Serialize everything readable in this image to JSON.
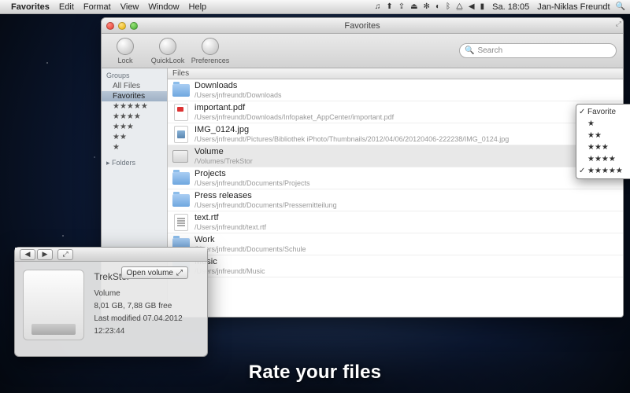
{
  "menubar": {
    "app": "Favorites",
    "items": [
      "Edit",
      "Format",
      "View",
      "Window",
      "Help"
    ],
    "clock": "Sa. 18:05",
    "user": "Jan-Niklas Freundt"
  },
  "window": {
    "title": "Favorites",
    "toolbar": {
      "lock": "Lock",
      "quicklook": "QuickLook",
      "preferences": "Preferences",
      "search_placeholder": "Search"
    },
    "sidebar": {
      "groups_label": "Groups",
      "items": [
        "All Files",
        "Favorites",
        "★★★★★",
        "★★★★",
        "★★★",
        "★★",
        "★"
      ],
      "selected_index": 1,
      "folders_label": "Folders"
    },
    "column_header": "Files",
    "files": [
      {
        "icon": "folder",
        "name": "Downloads",
        "path": "/Users/jnfreundt/Downloads"
      },
      {
        "icon": "pdf",
        "name": "important.pdf",
        "path": "/Users/jnfreundt/Downloads/Infopaket_AppCenter/important.pdf"
      },
      {
        "icon": "jpg",
        "name": "IMG_0124.jpg",
        "path": "/Users/jnfreundt/Pictures/Bibliothek iPhoto/Thumbnails/2012/04/06/20120406-222238/IMG_0124.jpg"
      },
      {
        "icon": "drive",
        "name": "Volume",
        "path": "/Volumes/TrekStor",
        "selected": true
      },
      {
        "icon": "folder",
        "name": "Projects",
        "path": "/Users/jnfreundt/Documents/Projects"
      },
      {
        "icon": "folder",
        "name": "Press releases",
        "path": "/Users/jnfreundt/Documents/Pressemitteilung"
      },
      {
        "icon": "rtf",
        "name": "text.rtf",
        "path": "/Users/jnfreundt/text.rtf"
      },
      {
        "icon": "folder",
        "name": "Work",
        "path": "/Users/jnfreundt/Documents/Schule"
      },
      {
        "icon": "folder",
        "name": "Music",
        "path": "/Users/jnfreundt/Music"
      }
    ],
    "rating_menu": {
      "items": [
        "Favorite",
        "★",
        "★★",
        "★★★",
        "★★★★",
        "★★★★★"
      ],
      "checked": [
        0,
        5
      ]
    }
  },
  "info_panel": {
    "open_button": "Open volume",
    "name": "TrekStor",
    "kind": "Volume",
    "size": "8,01 GB, 7,88 GB free",
    "modified": "Last modified 07.04.2012 12:23:44"
  },
  "caption": "Rate your files"
}
